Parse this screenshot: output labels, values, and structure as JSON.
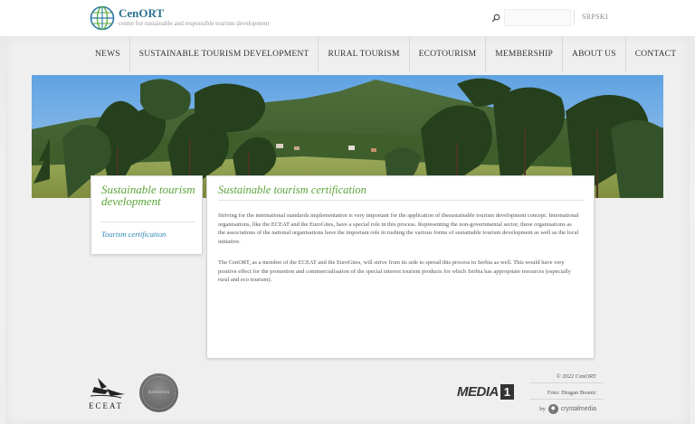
{
  "header": {
    "brand_name": "CenORT",
    "brand_tagline": "centre for sustainable and responsible tourism development",
    "search_placeholder": "",
    "language": "SRPSKI"
  },
  "nav": {
    "items": [
      {
        "label": "NEWS"
      },
      {
        "label": "SUSTAINABLE TOURISM DEVELOPMENT"
      },
      {
        "label": "RURAL TOURISM"
      },
      {
        "label": "ECOTOURISM"
      },
      {
        "label": "MEMBERSHIP"
      },
      {
        "label": "ABOUT US"
      },
      {
        "label": "CONTACT"
      }
    ]
  },
  "sidebar": {
    "title": "Sustainable tourism development",
    "link": "Tourism certification"
  },
  "main": {
    "title": "Sustainable tourism certification",
    "paragraph1": "Striving for the international standards implementation is very important for the application of thesustainable tourism development concept. International organisations, like the ECEAT and the EuroGites, have a special role in this process. Representing the non-governmental sector, these organisations as the associations of the national organisations have the important role in rushing the various forms of sustainable tourism development as well as the local initiative.",
    "paragraph2": "The CenORT, as a member of the ECEAT and the EuroGites, will strive from its side to spread this process in Serbia as well. This would have very positive effect for the promotion and commercialisation of the special interest tourism products for which Serbia has appropriate resources (especially rural and eco tourism)."
  },
  "footer": {
    "eceat_label": "ECEAT",
    "eurogites_label": "EUROGITES",
    "media_label": "MEDIA",
    "media_number": "1",
    "copyright": "© 2022 CenORT",
    "photo_credit": "Foto: Dragan Bosnic",
    "by_label": "by",
    "crystal_label": "crystalmedia"
  },
  "colors": {
    "accent_green": "#5aa63a",
    "link_blue": "#2b86b4",
    "brand_blue": "#2c6f8f"
  }
}
